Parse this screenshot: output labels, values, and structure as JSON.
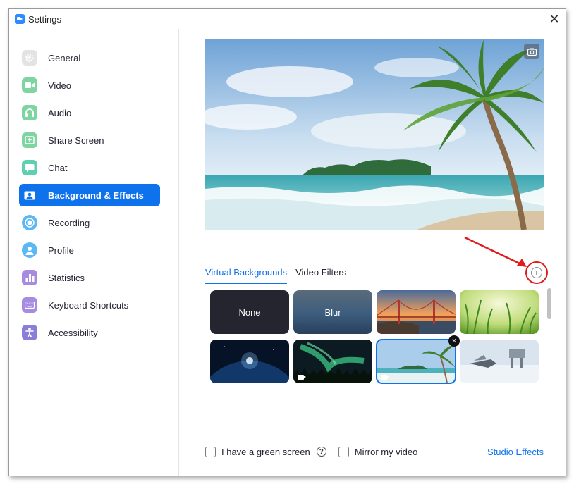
{
  "window": {
    "title": "Settings",
    "close_glyph": "✕"
  },
  "sidebar": {
    "items": [
      {
        "label": "General",
        "icon": "gear-icon",
        "color": "#e1e1e1"
      },
      {
        "label": "Video",
        "icon": "video-camera-icon",
        "color": "#7ed5a1"
      },
      {
        "label": "Audio",
        "icon": "headphones-icon",
        "color": "#7ed5a1"
      },
      {
        "label": "Share Screen",
        "icon": "share-screen-icon",
        "color": "#7ed5a1"
      },
      {
        "label": "Chat",
        "icon": "chat-icon",
        "color": "#5fcfb0"
      },
      {
        "label": "Background & Effects",
        "icon": "person-portrait-icon",
        "color": "#0e72ed",
        "active": true
      },
      {
        "label": "Recording",
        "icon": "record-icon",
        "color": "#5bb8f5"
      },
      {
        "label": "Profile",
        "icon": "profile-icon",
        "color": "#5bb8f5"
      },
      {
        "label": "Statistics",
        "icon": "statistics-icon",
        "color": "#a78be0"
      },
      {
        "label": "Keyboard Shortcuts",
        "icon": "keyboard-icon",
        "color": "#a78be0"
      },
      {
        "label": "Accessibility",
        "icon": "accessibility-icon",
        "color": "#8a7fd8"
      }
    ]
  },
  "main": {
    "tabs": [
      {
        "label": "Virtual Backgrounds",
        "active": true
      },
      {
        "label": "Video Filters",
        "active": false
      }
    ],
    "add_button_glyph": "+",
    "backgrounds": [
      {
        "label": "None",
        "kind": "none"
      },
      {
        "label": "Blur",
        "kind": "blur"
      },
      {
        "label": "",
        "kind": "golden-gate"
      },
      {
        "label": "",
        "kind": "grass"
      },
      {
        "label": "",
        "kind": "earth"
      },
      {
        "label": "",
        "kind": "aurora",
        "video": true
      },
      {
        "label": "",
        "kind": "beach",
        "video": true,
        "selected": true
      },
      {
        "label": "",
        "kind": "snow-walkers"
      }
    ],
    "remove_glyph": "×",
    "options": {
      "green_screen": "I have a green screen",
      "help_glyph": "?",
      "mirror": "Mirror my video",
      "studio_effects": "Studio Effects"
    }
  },
  "colors": {
    "accent": "#0e72ed",
    "annotation": "#e01b1b"
  }
}
